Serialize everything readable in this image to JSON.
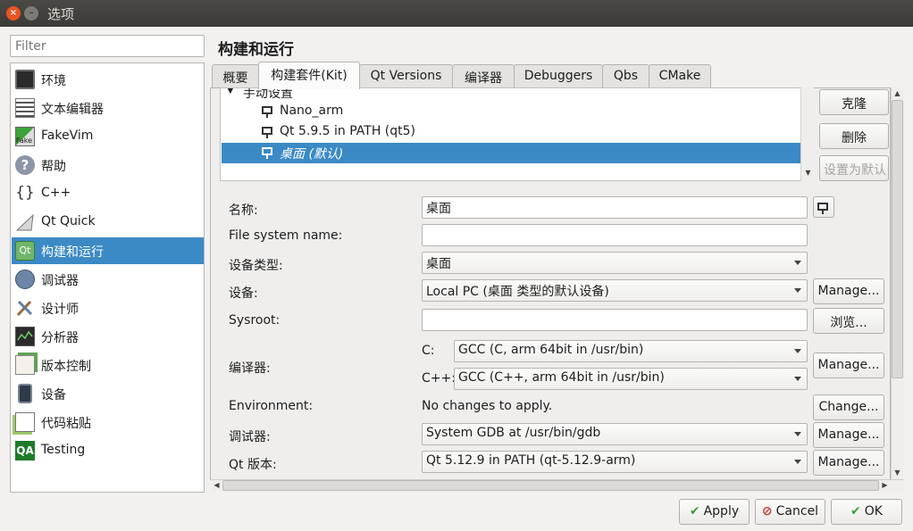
{
  "window": {
    "title": "选项"
  },
  "filter": {
    "placeholder": "Filter"
  },
  "categories": [
    {
      "label": "环境"
    },
    {
      "label": "文本编辑器"
    },
    {
      "label": "FakeVim"
    },
    {
      "label": "帮助"
    },
    {
      "label": "C++"
    },
    {
      "label": "Qt Quick"
    },
    {
      "label": "构建和运行",
      "selected": true
    },
    {
      "label": "调试器"
    },
    {
      "label": "设计师"
    },
    {
      "label": "分析器"
    },
    {
      "label": "版本控制"
    },
    {
      "label": "设备"
    },
    {
      "label": "代码粘贴"
    },
    {
      "label": "Testing"
    }
  ],
  "page_title": "构建和运行",
  "tabs": [
    {
      "label": "概要"
    },
    {
      "label": "构建套件(Kit)",
      "active": true
    },
    {
      "label": "Qt Versions"
    },
    {
      "label": "编译器"
    },
    {
      "label": "Debuggers"
    },
    {
      "label": "Qbs"
    },
    {
      "label": "CMake"
    }
  ],
  "kit_tree": {
    "group": "手动设置",
    "items": [
      {
        "label": "Nano_arm"
      },
      {
        "label": "Qt 5.9.5 in PATH (qt5)"
      },
      {
        "label": "桌面 (默认)",
        "selected": true
      }
    ]
  },
  "kit_buttons": {
    "clone": "克隆",
    "remove": "删除",
    "make_default": "设置为默认"
  },
  "form": {
    "name_label": "名称:",
    "name_value": "桌面",
    "fs_name_label": "File system name:",
    "fs_name_value": "",
    "device_type_label": "设备类型:",
    "device_type_value": "桌面",
    "device_label": "设备:",
    "device_value": "Local PC (桌面 类型的默认设备)",
    "sysroot_label": "Sysroot:",
    "sysroot_value": "",
    "compiler_label": "编译器:",
    "c_label": "C:",
    "c_value": "GCC (C, arm 64bit in /usr/bin)",
    "cpp_label": "C++:",
    "cpp_value": "GCC (C++, arm 64bit in /usr/bin)",
    "env_label": "Environment:",
    "env_value": "No changes to apply.",
    "debugger_label": "调试器:",
    "debugger_value": "System GDB at /usr/bin/gdb",
    "qt_label": "Qt 版本:",
    "qt_value": "Qt 5.12.9 in PATH (qt-5.12.9-arm)",
    "manage": "Manage...",
    "browse": "浏览...",
    "change": "Change..."
  },
  "dialog_buttons": {
    "apply": "Apply",
    "cancel": "Cancel",
    "ok": "OK"
  }
}
